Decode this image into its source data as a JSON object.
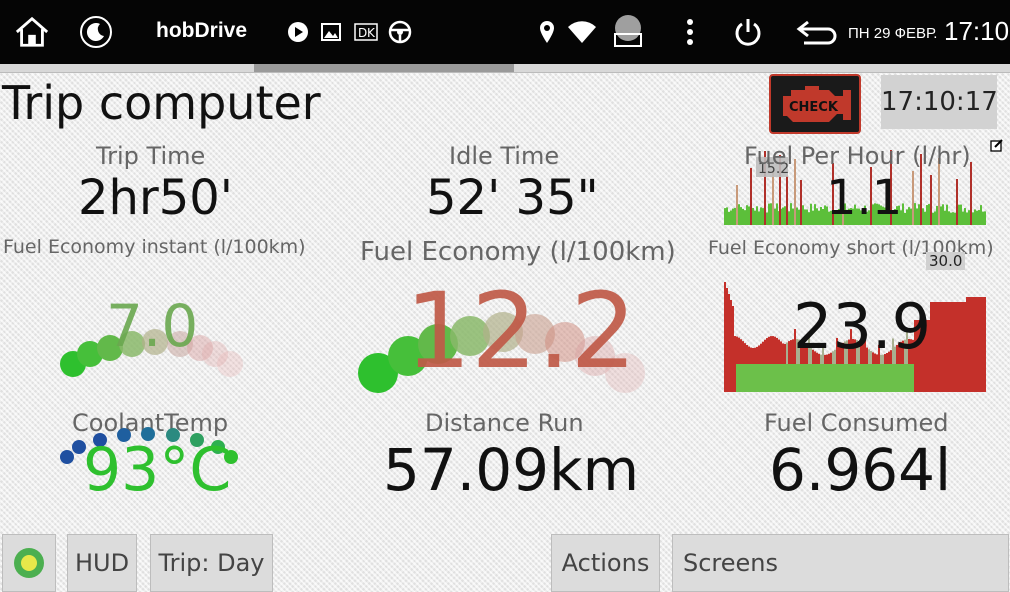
{
  "statusbar": {
    "app_name": "hobDrive",
    "date": "ПН 29 ФЕВР.",
    "time": "17:10"
  },
  "header": {
    "title": "Trip computer",
    "check_label": "CHECK",
    "clock": "17:10:17"
  },
  "gauges": {
    "trip_time": {
      "label": "Trip Time",
      "value": "2hr50'"
    },
    "idle_time": {
      "label": "Idle Time",
      "value": "52' 35\""
    },
    "fuel_per_hour": {
      "label": "Fuel Per Hour (l/hr)",
      "value": "1.1",
      "peak": "15.2"
    },
    "fuel_economy_instant": {
      "label": "Fuel Economy instant (l/100km)",
      "value": "7.0"
    },
    "fuel_economy": {
      "label": "Fuel Economy (l/100km)",
      "value": "12.2"
    },
    "fuel_economy_short": {
      "label": "Fuel Economy short (l/100km)",
      "value": "23.9",
      "peak": "30.0"
    },
    "coolant_temp": {
      "label": "CoolantTemp",
      "value": "93°C"
    },
    "distance_run": {
      "label": "Distance Run",
      "value": "57.09km"
    },
    "fuel_consumed": {
      "label": "Fuel Consumed",
      "value": "6.964l"
    }
  },
  "toolbar": {
    "hud_label": "HUD",
    "trip_label": "Trip: Day",
    "actions_label": "Actions",
    "screens_label": "Screens"
  },
  "colors": {
    "green": "#2ec02e",
    "red": "#c0392b",
    "value_red": "#c05a48",
    "blue": "#1f4fa0"
  }
}
